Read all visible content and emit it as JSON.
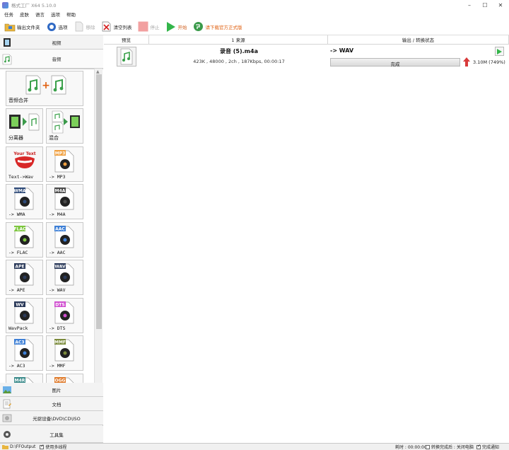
{
  "window": {
    "title": "格式工厂 X64 5.10.0"
  },
  "menu": [
    "任务",
    "皮肤",
    "语言",
    "选项",
    "帮助"
  ],
  "toolbar": {
    "output_folder": "输出文件夹",
    "options": "选项",
    "remove": "移除",
    "clear_list": "清空列表",
    "stop": "停止",
    "start": "开始",
    "download": "请下载官方正式版"
  },
  "categories": {
    "video": "视频",
    "audio": "音频",
    "image": "图片",
    "document": "文档",
    "disc": "光驱设备\\DVD\\CD\\ISO",
    "tools": "工具集"
  },
  "audio_tiles": [
    {
      "label": "音频合并",
      "icon": "audio-merge-icon"
    },
    {
      "label": "分离器",
      "icon": "splitter-icon"
    },
    {
      "label": "混合",
      "icon": "mix-icon"
    },
    {
      "label": "Text->Wav",
      "icon": "text-to-speech-icon"
    },
    {
      "label": "-> MP3",
      "icon": "mp3-icon",
      "badge": "MP3",
      "color": "#f0a040"
    },
    {
      "label": "-> WMA",
      "icon": "wma-icon",
      "badge": "WMA",
      "color": "#2e4a78"
    },
    {
      "label": "-> M4A",
      "icon": "m4a-icon",
      "badge": "M4A",
      "color": "#4a4a4a"
    },
    {
      "label": "-> FLAC",
      "icon": "flac-icon",
      "badge": "FLAC",
      "color": "#7cc63d"
    },
    {
      "label": "-> AAC",
      "icon": "aac-icon",
      "badge": "AAC",
      "color": "#3d7fd6"
    },
    {
      "label": "-> APE",
      "icon": "ape-icon",
      "badge": "APE",
      "color": "#2b3a5a"
    },
    {
      "label": "-> WAV",
      "icon": "wav-icon",
      "badge": "WAV",
      "color": "#2b3a5a"
    },
    {
      "label": "WavPack",
      "icon": "wavpack-icon",
      "badge": "WV",
      "color": "#2b3a5a"
    },
    {
      "label": "-> DTS",
      "icon": "dts-icon",
      "badge": "DTS",
      "color": "#d04fd0"
    },
    {
      "label": "-> AC3",
      "icon": "ac3-icon",
      "badge": "AC3",
      "color": "#3d7fd6"
    },
    {
      "label": "-> MMF",
      "icon": "mmf-icon",
      "badge": "MMF",
      "color": "#7a8a3a"
    },
    {
      "label": "",
      "icon": "m4r-icon",
      "badge": "M4R",
      "color": "#3a8a8a"
    },
    {
      "label": "",
      "icon": "ogg-icon",
      "badge": "OGG",
      "color": "#e07a2a"
    }
  ],
  "list": {
    "headers": {
      "preview": "预览",
      "source": "1 来源",
      "output": "输出 / 转换状态"
    },
    "rows": [
      {
        "filename": "录音 (5).m4a",
        "info": "423K , 48000 , 2ch , 187Kbps, 00:00:17",
        "target": "-> WAV",
        "status": "完成",
        "progress": 1.0,
        "size": "3.10M",
        "ratio": "(749%)"
      }
    ]
  },
  "statusbar": {
    "output_path": "D:\\FFOutput",
    "multithread_label": "使用多线程",
    "multithread": true,
    "elapsed": "耗时 : 00:00:00",
    "after_convert_label": "转换完成后 : 关闭电脑",
    "shutdown": false,
    "notify_label": "完成通知",
    "notify": true
  },
  "colors": {
    "accent_green": "#33b54a",
    "arrow_red": "#d83a3a",
    "download_orange": "#e06010"
  }
}
